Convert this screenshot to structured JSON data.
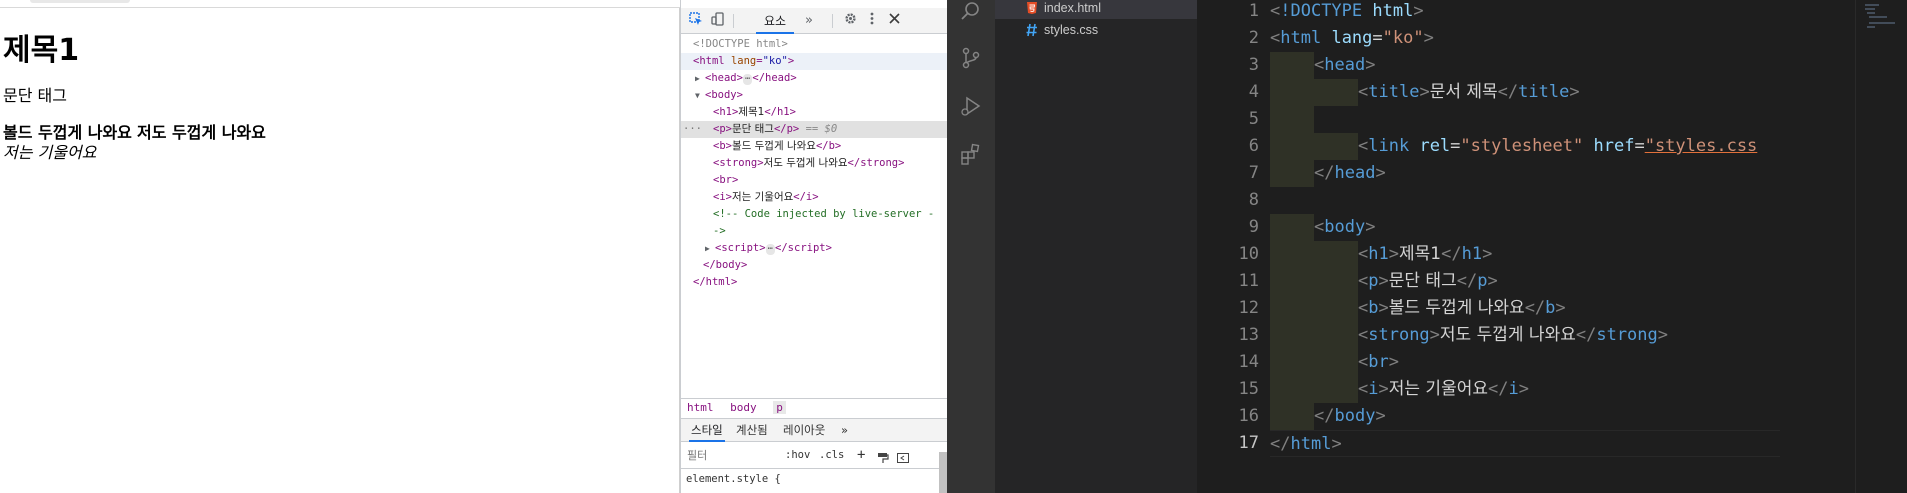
{
  "browser": {
    "heading": "제목1",
    "paragraph": "문단 태그",
    "bold_text": "볼드 두껍게 나와요",
    "strong_text": "저도 두껍게 나와요",
    "italic_text": "저는 기울어요"
  },
  "devtools": {
    "tab_elements": "요소",
    "more_tabs": "»",
    "tree": {
      "doctype": "<!DOCTYPE html>",
      "html_open": "html",
      "lang_attr": "lang",
      "lang_value": "\"ko\"",
      "head": "head",
      "body": "body",
      "h1_text": "제목1",
      "p_text": "문단 태그",
      "eq0": "== $0",
      "b_text": "볼드 두껍게 나와요",
      "strong_text": "저도 두껍게 나와요",
      "i_text": "저는 기울어요",
      "comment": "<!-- Code injected by live-server -",
      "comment_end": "->",
      "script": "script"
    },
    "breadcrumbs": [
      "html",
      "body",
      "p"
    ],
    "styles_tabs": [
      "스타일",
      "계산됨",
      "레이아웃",
      "»"
    ],
    "filter_placeholder": "필터",
    "hov": ":hov",
    "cls": ".cls",
    "element_style": "element.style {"
  },
  "vscode": {
    "files": [
      {
        "name": "index.html",
        "icon": "html-file-icon",
        "color": "#e44d26"
      },
      {
        "name": "styles.css",
        "icon": "css-file-icon",
        "color": "#42a5f5"
      }
    ],
    "line_numbers": [
      "1",
      "2",
      "3",
      "4",
      "5",
      "6",
      "7",
      "8",
      "9",
      "10",
      "11",
      "12",
      "13",
      "14",
      "15",
      "16",
      "17"
    ],
    "code": {
      "l1_doctype": "!DOCTYPE",
      "l1_html": "html",
      "l2_tag": "html",
      "l2_attr": "lang",
      "l2_val": "\"ko\"",
      "l3_tag": "head",
      "l4_tag": "title",
      "l4_text": "문서 제목",
      "l6_tag": "link",
      "l6_attr1": "rel",
      "l6_val1": "\"stylesheet\"",
      "l6_attr2": "href",
      "l6_val2": "\"styles.css",
      "l7_tag": "head",
      "l9_tag": "body",
      "l10_tag": "h1",
      "l10_text": "제목1",
      "l11_tag": "p",
      "l11_text": "문단 태그",
      "l12_tag": "b",
      "l12_text": "볼드 두껍게 나와요",
      "l13_tag": "strong",
      "l13_text": "저도 두껍게 나와요",
      "l14_tag": "br",
      "l15_tag": "i",
      "l15_text": "저는 기울어요",
      "l16_tag": "body",
      "l17_tag": "html"
    }
  },
  "colors": {
    "vscode_tag": "#569cd6",
    "vscode_attr": "#9cdcfe",
    "vscode_string": "#ce9178",
    "devtools_tag": "#881280",
    "devtools_accent": "#1a73e8"
  }
}
